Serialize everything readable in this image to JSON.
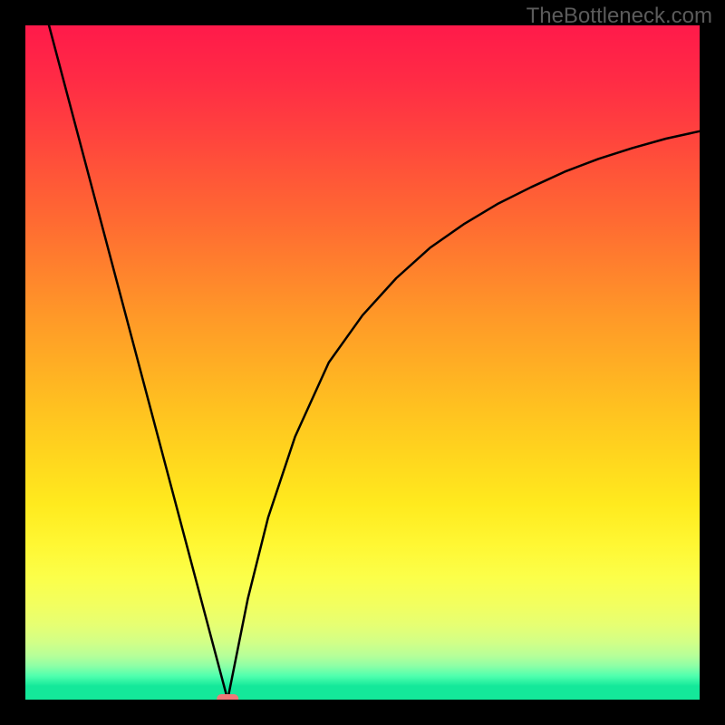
{
  "watermark": "TheBottleneck.com",
  "chart_data": {
    "type": "line",
    "title": "",
    "xlabel": "",
    "ylabel": "",
    "xlim": [
      0,
      100
    ],
    "ylim": [
      0,
      100
    ],
    "x_minimum": 30,
    "marker": {
      "x": 30,
      "y": 0,
      "color": "#f07878"
    },
    "curve_left": [
      {
        "x": 3.5,
        "y": 100
      },
      {
        "x": 30,
        "y": 0
      }
    ],
    "curve_right": [
      {
        "x": 30,
        "y": 0
      },
      {
        "x": 33,
        "y": 15
      },
      {
        "x": 36,
        "y": 27
      },
      {
        "x": 40,
        "y": 39
      },
      {
        "x": 45,
        "y": 50
      },
      {
        "x": 50,
        "y": 57
      },
      {
        "x": 55,
        "y": 62.5
      },
      {
        "x": 60,
        "y": 67
      },
      {
        "x": 65,
        "y": 70.5
      },
      {
        "x": 70,
        "y": 73.5
      },
      {
        "x": 75,
        "y": 76
      },
      {
        "x": 80,
        "y": 78.3
      },
      {
        "x": 85,
        "y": 80.2
      },
      {
        "x": 90,
        "y": 81.8
      },
      {
        "x": 95,
        "y": 83.2
      },
      {
        "x": 100,
        "y": 84.3
      }
    ],
    "gradient_bands": [
      {
        "y_top": 100,
        "color": "#ff1a4a"
      },
      {
        "y_top": 92,
        "color": "#ff2b45"
      },
      {
        "y_top": 85,
        "color": "#ff3f3f"
      },
      {
        "y_top": 78,
        "color": "#ff5538"
      },
      {
        "y_top": 71,
        "color": "#ff6a32"
      },
      {
        "y_top": 64,
        "color": "#ff812d"
      },
      {
        "y_top": 57,
        "color": "#ff9828"
      },
      {
        "y_top": 50,
        "color": "#ffad24"
      },
      {
        "y_top": 43,
        "color": "#ffc220"
      },
      {
        "y_top": 36,
        "color": "#ffd61e"
      },
      {
        "y_top": 29,
        "color": "#ffea1e"
      },
      {
        "y_top": 23,
        "color": "#fff733"
      },
      {
        "y_top": 18,
        "color": "#fbff4a"
      },
      {
        "y_top": 14,
        "color": "#f2ff60"
      },
      {
        "y_top": 11,
        "color": "#e6ff73"
      },
      {
        "y_top": 8.5,
        "color": "#d2ff87"
      },
      {
        "y_top": 6.5,
        "color": "#b6ff99"
      },
      {
        "y_top": 5,
        "color": "#8dffa6"
      },
      {
        "y_top": 3.5,
        "color": "#4fffae"
      },
      {
        "y_top": 2,
        "color": "#14e89a"
      },
      {
        "y_top": 0,
        "color": "#14e89a"
      }
    ],
    "frame_color": "#000000",
    "frame_width": 28,
    "curve_color": "#000000",
    "curve_width": 2.5
  }
}
